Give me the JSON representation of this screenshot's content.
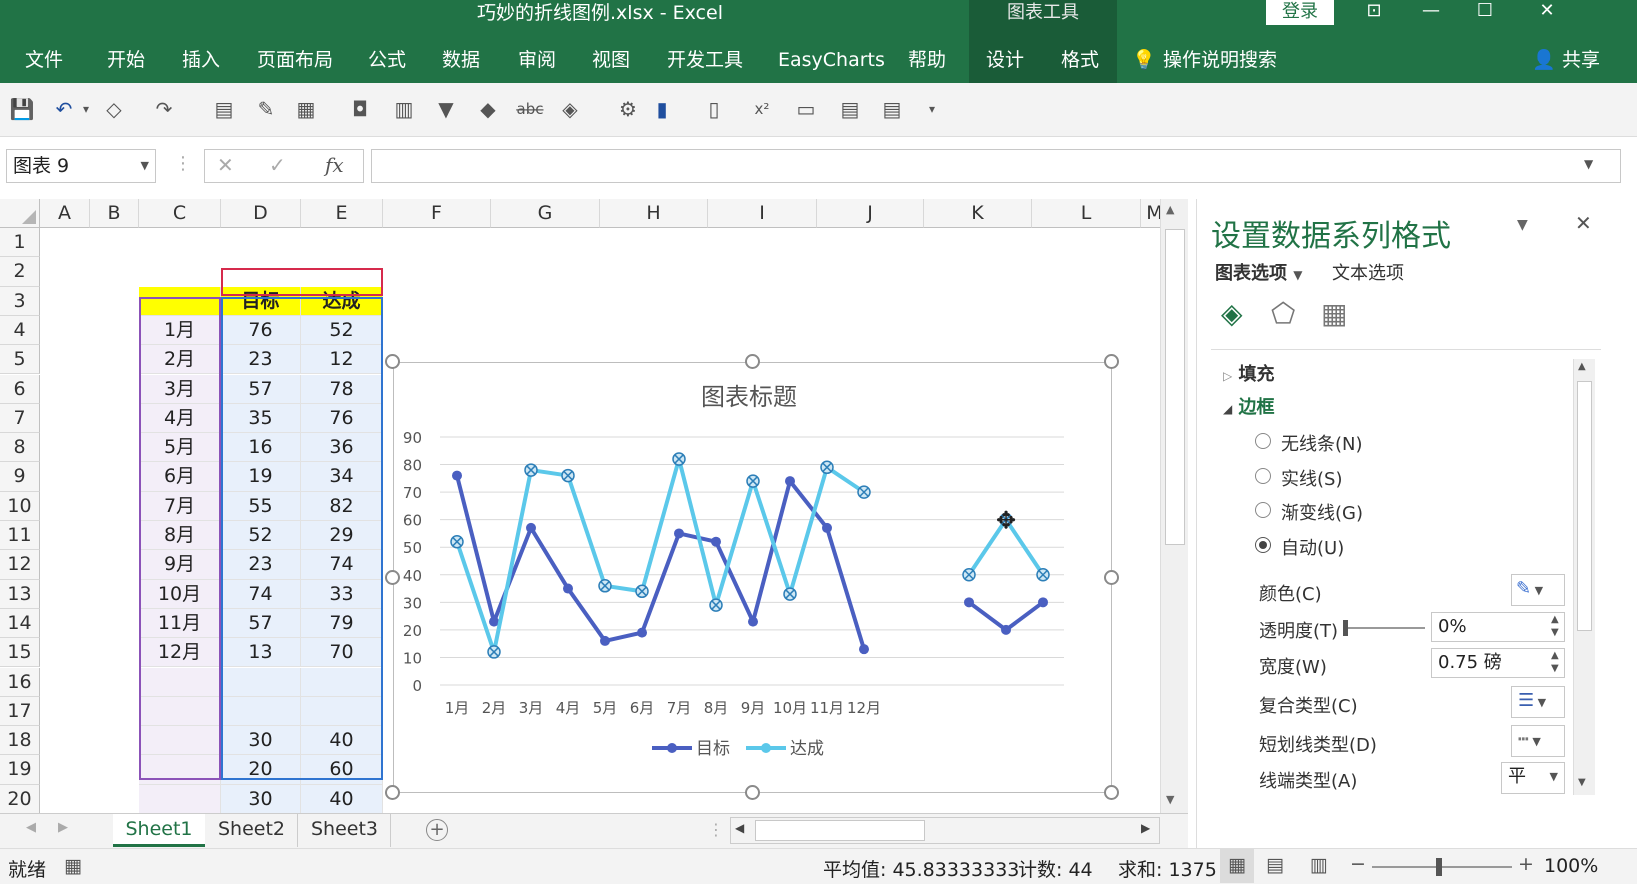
{
  "window": {
    "title": "巧妙的折线图例.xlsx  -  Excel",
    "context_group": "图表工具",
    "login": "登录",
    "ribbon_display_icon": "ribbon-display-icon",
    "minimize_icon": "minimize-icon",
    "maximize_icon": "maximize-icon",
    "close_icon": "close-icon"
  },
  "ribbon": {
    "tabs": [
      "文件",
      "开始",
      "插入",
      "页面布局",
      "公式",
      "数据",
      "审阅",
      "视图",
      "开发工具",
      "EasyCharts",
      "帮助",
      "设计",
      "格式"
    ],
    "tell_me": "操作说明搜索",
    "share": "共享"
  },
  "formula_bar": {
    "name_box": "图表 9",
    "fx": "fx",
    "formula": ""
  },
  "sheet": {
    "columns": [
      "A",
      "B",
      "C",
      "D",
      "E",
      "F",
      "G",
      "H",
      "I",
      "J",
      "K",
      "L",
      "M"
    ],
    "rows": [
      "1",
      "2",
      "3",
      "4",
      "5",
      "6",
      "7",
      "8",
      "9",
      "10",
      "11",
      "12",
      "13",
      "14",
      "15",
      "16",
      "17",
      "18",
      "19",
      "20"
    ],
    "header_target": "目标",
    "header_actual": "达成",
    "months": [
      "1月",
      "2月",
      "3月",
      "4月",
      "5月",
      "6月",
      "7月",
      "8月",
      "9月",
      "10月",
      "11月",
      "12月"
    ],
    "target": [
      "76",
      "23",
      "57",
      "35",
      "16",
      "19",
      "55",
      "52",
      "23",
      "74",
      "57",
      "13"
    ],
    "actual": [
      "52",
      "12",
      "78",
      "76",
      "36",
      "34",
      "82",
      "29",
      "74",
      "33",
      "79",
      "70"
    ],
    "legend_target": [
      "30",
      "20",
      "30"
    ],
    "legend_actual": [
      "40",
      "60",
      "40"
    ]
  },
  "chart_data": {
    "type": "line",
    "title": "图表标题",
    "categories": [
      "1月",
      "2月",
      "3月",
      "4月",
      "5月",
      "6月",
      "7月",
      "8月",
      "9月",
      "10月",
      "11月",
      "12月"
    ],
    "series": [
      {
        "name": "目标",
        "values": [
          76,
          23,
          57,
          35,
          16,
          19,
          55,
          52,
          23,
          74,
          57,
          13
        ],
        "color": "#4a5fc1"
      },
      {
        "name": "达成",
        "values": [
          52,
          12,
          78,
          76,
          36,
          34,
          82,
          29,
          74,
          33,
          79,
          70
        ],
        "color": "#5bc8ea"
      }
    ],
    "legend_lines": [
      {
        "values": [
          30,
          20,
          30
        ],
        "color": "#4a5fc1"
      },
      {
        "values": [
          40,
          60,
          40
        ],
        "color": "#5bc8ea"
      }
    ],
    "ylim": [
      0,
      90
    ],
    "yticks": [
      "0",
      "10",
      "20",
      "30",
      "40",
      "50",
      "60",
      "70",
      "80",
      "90"
    ],
    "grid": true,
    "legend_position": "bottom"
  },
  "sheet_tabs": [
    "Sheet1",
    "Sheet2",
    "Sheet3"
  ],
  "status": {
    "ready": "就绪",
    "average": "平均值: 45.83333333",
    "count": "计数: 44",
    "sum": "求和: 1375",
    "zoom": "100%"
  },
  "pane": {
    "title": "设置数据系列格式",
    "tab_chart": "图表选项",
    "tab_text": "文本选项",
    "fill": "填充",
    "border": "边框",
    "options": [
      "无线条(N)",
      "实线(S)",
      "渐变线(G)",
      "自动(U)"
    ],
    "color_label": "颜色(C)",
    "transparency_label": "透明度(T)",
    "transparency_value": "0%",
    "width_label": "宽度(W)",
    "width_value": "0.75 磅",
    "compound_label": "复合类型(C)",
    "dash_label": "短划线类型(D)",
    "cap_label": "线端类型(A)",
    "cap_value": "平"
  }
}
